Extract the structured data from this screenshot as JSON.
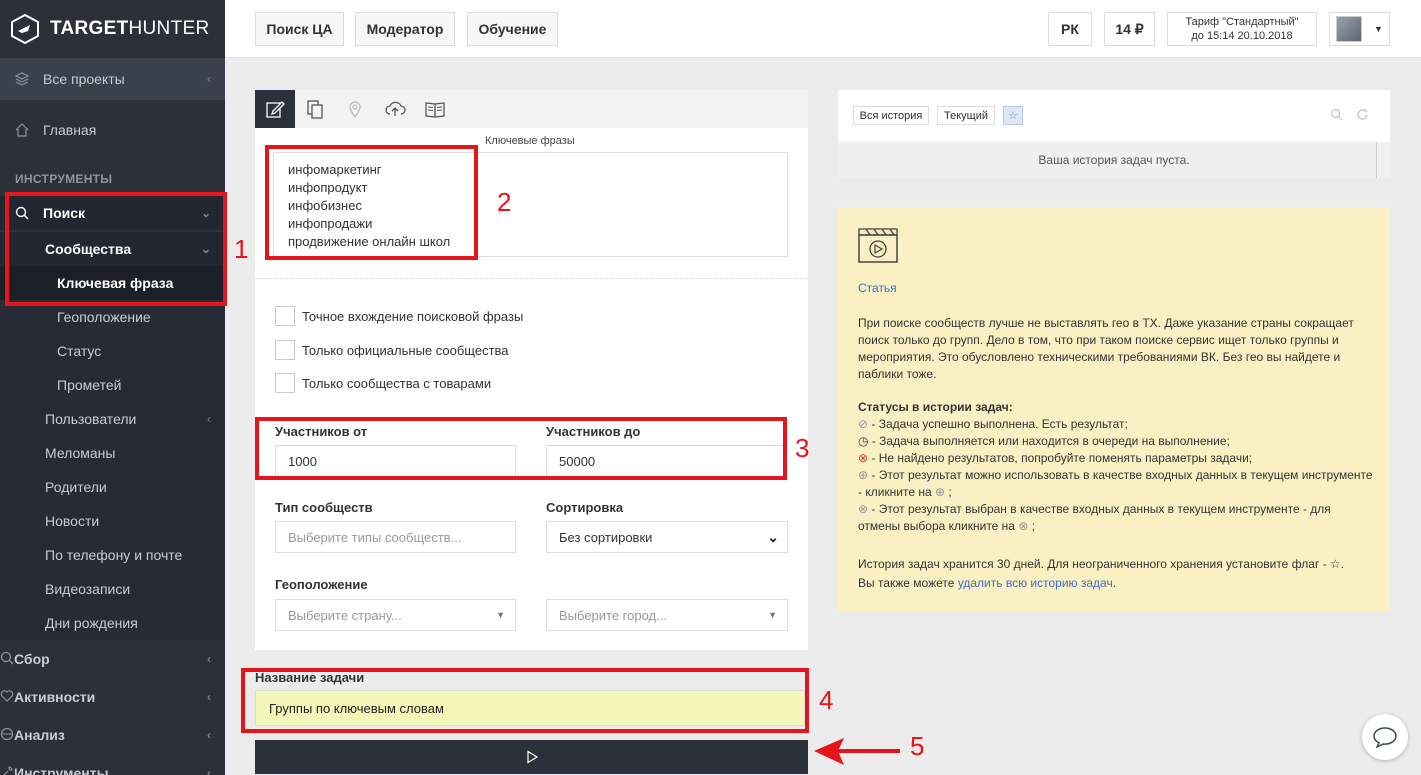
{
  "logo": {
    "brand_bold": "TARGET",
    "brand_light": "HUNTER",
    "brand_rest": "HUNTER"
  },
  "sidebar": {
    "projects": "Все проекты",
    "home": "Главная",
    "section_tools": "ИНСТРУМЕНТЫ",
    "search": "Поиск",
    "communities": "Сообщества",
    "sub_items": [
      "Ключевая фраза",
      "Геоположение",
      "Статус",
      "Прометей"
    ],
    "sections": [
      {
        "label": "Пользователи",
        "chevron": true
      },
      {
        "label": "Меломаны",
        "chevron": false
      },
      {
        "label": "Родители",
        "chevron": false
      },
      {
        "label": "Новости",
        "chevron": false
      },
      {
        "label": "По телефону и почте",
        "chevron": false
      },
      {
        "label": "Видеозаписи",
        "chevron": false
      },
      {
        "label": "Дни рождения",
        "chevron": false
      }
    ],
    "groups": [
      "Сбор",
      "Активности",
      "Анализ",
      "Инструменты"
    ]
  },
  "topbar": {
    "btn_search_ca": "Поиск ЦА",
    "btn_moderator": "Модератор",
    "btn_learning": "Обучение",
    "btn_rk": "РК",
    "balance": "14 ₽",
    "tariff_line1": "Тариф \"Стандартный\"",
    "tariff_line2": "до 15:14 20.10.2018"
  },
  "form": {
    "keywords_label": "Ключевые фразы",
    "keywords": [
      "инфомаркетинг",
      "инфопродукт",
      "инфобизнес",
      "инфопродажи",
      "продвижение онлайн школ"
    ],
    "checkboxes": [
      "Точное вхождение поисковой фразы",
      "Только официальные сообщества",
      "Только сообщества с товарами"
    ],
    "members_from_label": "Участников от",
    "members_from": "1000",
    "members_to_label": "Участников до",
    "members_to": "50000",
    "type_label": "Тип сообществ",
    "type_placeholder": "Выберите типы сообществ...",
    "sort_label": "Сортировка",
    "sort_value": "Без сортировки",
    "geo_label": "Геоположение",
    "country_placeholder": "Выберите страну...",
    "city_placeholder": "Выберите город...",
    "task_label": "Название задачи",
    "task_value": "Группы по ключевым словам"
  },
  "history": {
    "btn_all": "Вся история",
    "btn_current": "Текущий",
    "empty": "Ваша история задач пуста."
  },
  "info": {
    "article_link": "Статья",
    "para1": "При поиске сообществ лучше не выставлять гео в ТХ. Даже указание страны сокращает поиск только до групп. Дело в том, что при таком поиске сервис ищет только группы и мероприятия. Это обусловлено техническими требованиями ВК. Без гео вы найдете и паблики тоже.",
    "statuses_title": "Статусы в истории задач:",
    "status1": "- Задача успешно выполнена. Есть результат;",
    "status2": "- Задача выполняется или находится в очереди на выполнение;",
    "status3": "- Не найдено результатов, попробуйте поменять параметры задачи;",
    "status4a": "- Этот результат можно использовать в качестве входных данных в текущем инструменте - кликните на",
    "status4b": ";",
    "status5a": "- Этот результат выбран в качестве входных данных в текущем инструменте - для отмены выбора кликните на",
    "status5b": ";",
    "footer1": "История задач хранится 30 дней. Для неограниченного хранения установите флаг -",
    "footer2a": "Вы также можете",
    "footer2_link": "удалить всю историю задач",
    "footer2b": "."
  },
  "annotations": [
    "1",
    "2",
    "3",
    "4",
    "5"
  ],
  "colors": {
    "sidebar": "#2b303b",
    "accent_red": "#e8141b",
    "info_bg": "#fbf0c4",
    "task_bg": "#f4f7b8",
    "link": "#3b6fc4"
  }
}
